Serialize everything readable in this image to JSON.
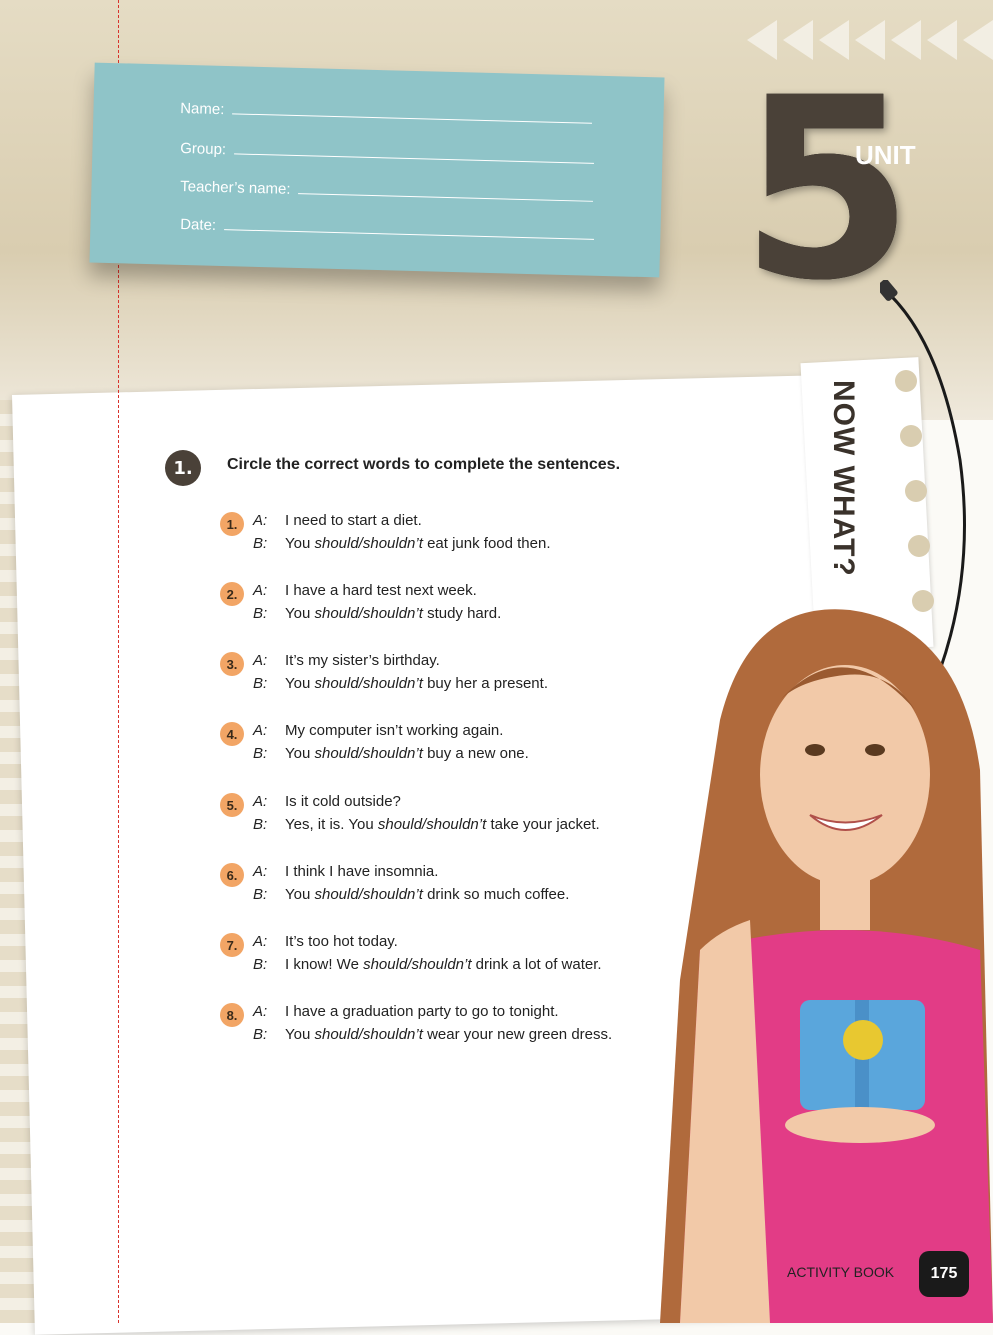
{
  "form": {
    "name_label": "Name:",
    "group_label": "Group:",
    "teacher_label": "Teacher’s name:",
    "date_label": "Date:"
  },
  "unit": {
    "number": "5",
    "label": "UNIT",
    "title": "NOW WHAT?"
  },
  "exercise": {
    "number": "1.",
    "instructions": "Circle the correct words to complete the sentences.",
    "items": [
      {
        "num": "1.",
        "a": "I need to start a diet.",
        "b_pre": "You ",
        "b_choice": "should/shouldn’t",
        "b_post": " eat junk food then."
      },
      {
        "num": "2.",
        "a": "I have a hard test next week.",
        "b_pre": "You ",
        "b_choice": "should/shouldn’t",
        "b_post": " study hard."
      },
      {
        "num": "3.",
        "a": "It’s my sister’s birthday.",
        "b_pre": "You ",
        "b_choice": "should/shouldn’t",
        "b_post": " buy her a present."
      },
      {
        "num": "4.",
        "a": "My computer isn’t working again.",
        "b_pre": "You ",
        "b_choice": "should/shouldn’t",
        "b_post": " buy a new one."
      },
      {
        "num": "5.",
        "a": "Is it cold outside?",
        "b_pre": "Yes, it is. You ",
        "b_choice": "should/shouldn’t",
        "b_post": " take your jacket."
      },
      {
        "num": "6.",
        "a": "I think I have insomnia.",
        "b_pre": "You ",
        "b_choice": "should/shouldn’t",
        "b_post": " drink so much coffee."
      },
      {
        "num": "7.",
        "a": "It’s too hot today.",
        "b_pre": "I know! We ",
        "b_choice": "should/shouldn’t",
        "b_post": " drink a lot of water."
      },
      {
        "num": "8.",
        "a": "I have a graduation party to go to tonight.",
        "b_pre": "You ",
        "b_choice": "should/shouldn’t",
        "b_post": " wear your new green dress."
      }
    ],
    "speaker_a": "A:",
    "speaker_b": "B:"
  },
  "footer": {
    "book": "ACTIVITY BOOK",
    "page": "175"
  }
}
